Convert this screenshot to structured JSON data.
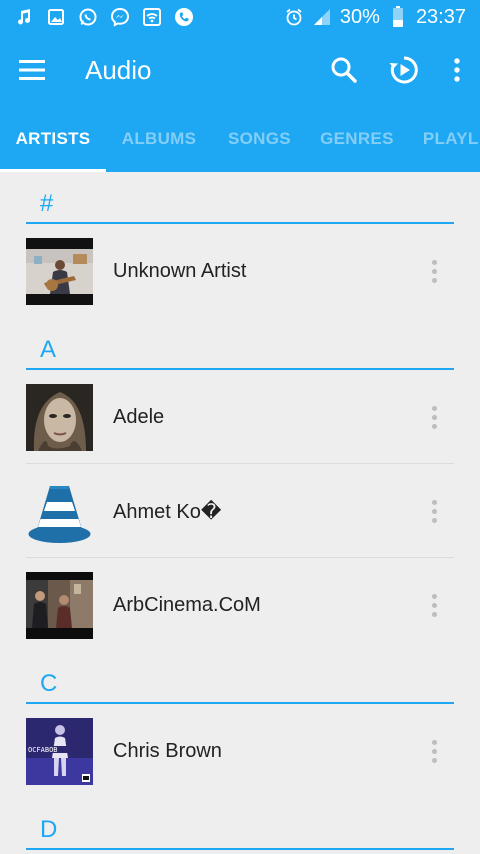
{
  "status_bar": {
    "battery_percent": "30%",
    "time": "23:37",
    "left_icons": [
      "music-note-icon",
      "image-icon",
      "whatsapp-icon",
      "messenger-icon",
      "wifi-icon",
      "phone-icon"
    ],
    "right_icons": [
      "alarm-icon",
      "signal-icon",
      "battery-icon"
    ]
  },
  "app_bar": {
    "title": "Audio",
    "actions": [
      "search-icon",
      "resume-playback-icon",
      "more-vert-icon"
    ]
  },
  "tabs": [
    "ARTISTS",
    "ALBUMS",
    "SONGS",
    "GENRES",
    "PLAYL"
  ],
  "active_tab": 0,
  "sections": [
    {
      "letter": "#",
      "items": [
        {
          "name": "Unknown Artist",
          "thumb": "video-thumb"
        }
      ]
    },
    {
      "letter": "A",
      "items": [
        {
          "name": "Adele",
          "thumb": "portrait-thumb"
        },
        {
          "name": "Ahmet Ko�",
          "thumb": "vlc-cone-thumb"
        },
        {
          "name": "ArbCinema.CoM",
          "thumb": "movie-thumb"
        }
      ]
    },
    {
      "letter": "C",
      "items": [
        {
          "name": "Chris Brown",
          "thumb": "album-cover-thumb"
        }
      ]
    },
    {
      "letter": "D",
      "items": []
    }
  ],
  "colors": {
    "primary": "#1ea7f2",
    "background": "#eeeeee"
  }
}
